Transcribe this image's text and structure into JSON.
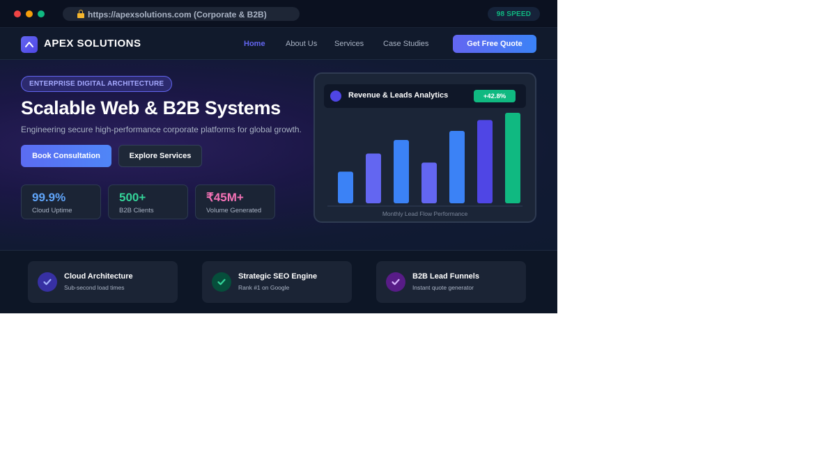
{
  "browser": {
    "url": "https://apexsolutions.com (Corporate & B2B)",
    "speed_badge": "98 SPEED"
  },
  "nav": {
    "logo_text": "APEX SOLUTIONS",
    "links": [
      "Home",
      "About Us",
      "Services",
      "Case Studies"
    ],
    "active_link": "Home",
    "cta": "Get Free Quote"
  },
  "hero": {
    "badge": "ENTERPRISE DIGITAL ARCHITECTURE",
    "title": "Scalable Web & B2B Systems",
    "subtitle": "Engineering secure high-performance corporate platforms for global growth.",
    "primary_button": "Book Consultation",
    "secondary_button": "Explore Services",
    "stats": [
      {
        "value": "99.9%",
        "label": "Cloud Uptime",
        "color": "#60a5fa"
      },
      {
        "value": "500+",
        "label": "B2B Clients",
        "color": "#34d399"
      },
      {
        "value": "₹45M+",
        "label": "Volume Generated",
        "color": "#f472b6"
      }
    ]
  },
  "chart_card": {
    "title": "Revenue & Leads Analytics",
    "growth_badge": "+42.8%",
    "caption": "Monthly Lead Flow Performance"
  },
  "chart_data": {
    "type": "bar",
    "values": [
      35,
      55,
      70,
      45,
      80,
      92,
      100
    ],
    "value_scale": "relative bar height, percent of tallest bar",
    "colors": [
      "#3b82f6",
      "#6366f1",
      "#3b82f6",
      "#6366f1",
      "#3b82f6",
      "#4f46e5",
      "#10b981"
    ],
    "grid": false
  },
  "features": [
    {
      "title": "Cloud Architecture",
      "subtitle": "Sub-second load times",
      "icon": "check-icon",
      "bg": "#3730a3",
      "fg": "#a5b4fc"
    },
    {
      "title": "Strategic SEO Engine",
      "subtitle": "Rank #1 on Google",
      "icon": "check-icon",
      "bg": "#064e3b",
      "fg": "#34d399"
    },
    {
      "title": "B2B Lead Funnels",
      "subtitle": "Instant quote generator",
      "icon": "check-icon",
      "bg": "#581c87",
      "fg": "#d8b4fe"
    }
  ]
}
